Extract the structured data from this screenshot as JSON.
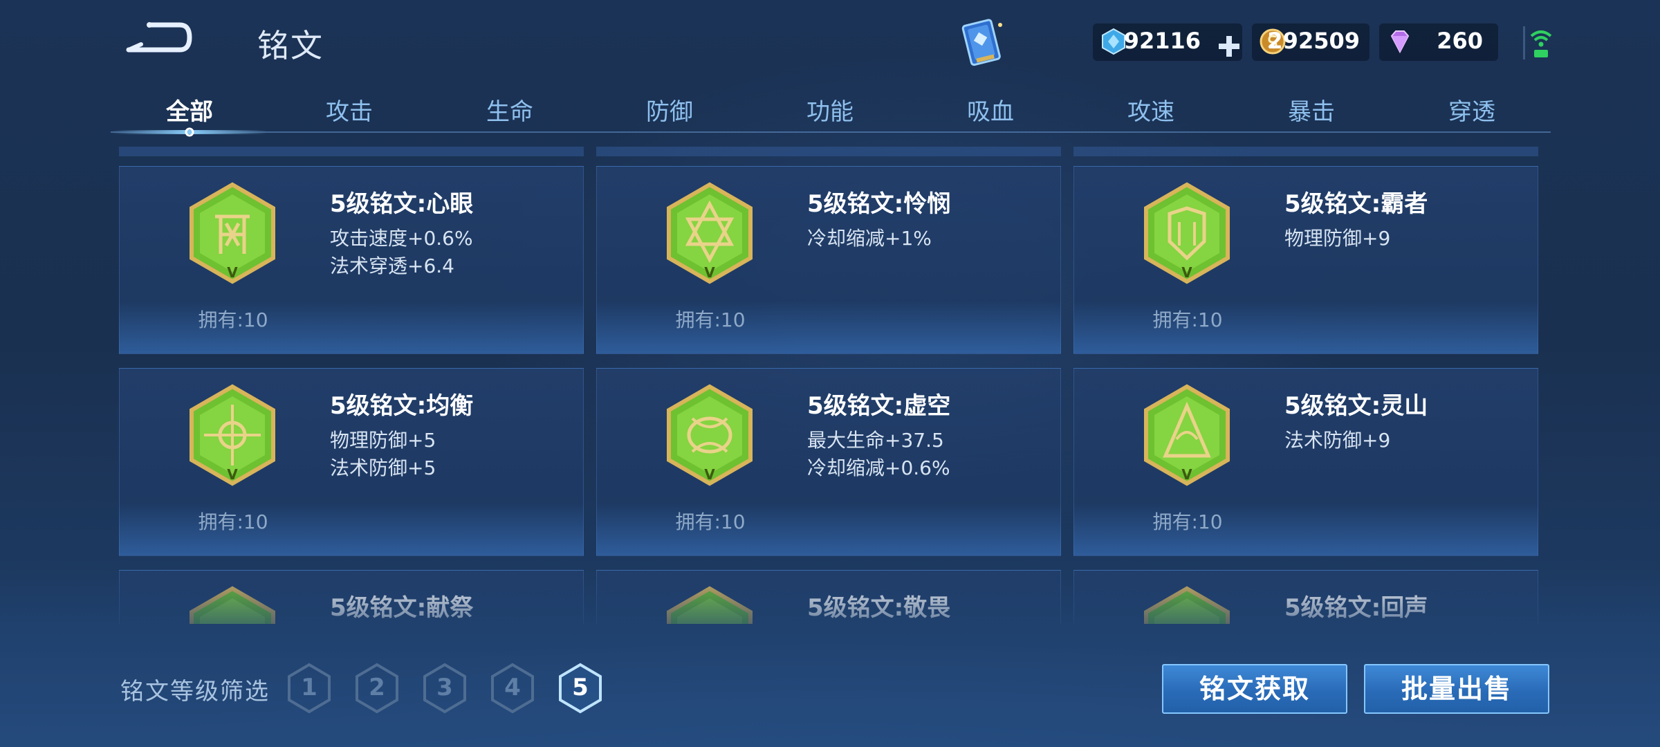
{
  "header": {
    "title": "铭文",
    "currency": {
      "gems": "92116",
      "gold": "292509",
      "diamonds": "260"
    }
  },
  "tabs": [
    {
      "label": "全部",
      "active": true
    },
    {
      "label": "攻击",
      "active": false
    },
    {
      "label": "生命",
      "active": false
    },
    {
      "label": "防御",
      "active": false
    },
    {
      "label": "功能",
      "active": false
    },
    {
      "label": "吸血",
      "active": false
    },
    {
      "label": "攻速",
      "active": false
    },
    {
      "label": "暴击",
      "active": false
    },
    {
      "label": "穿透",
      "active": false
    }
  ],
  "inscriptions": [
    {
      "name": "5级铭文:心眼",
      "stats": [
        "攻击速度+0.6%",
        "法术穿透+6.4"
      ],
      "owned": "拥有:10"
    },
    {
      "name": "5级铭文:怜悯",
      "stats": [
        "冷却缩减+1%"
      ],
      "owned": "拥有:10"
    },
    {
      "name": "5级铭文:霸者",
      "stats": [
        "物理防御+9"
      ],
      "owned": "拥有:10"
    },
    {
      "name": "5级铭文:均衡",
      "stats": [
        "物理防御+5",
        "法术防御+5"
      ],
      "owned": "拥有:10"
    },
    {
      "name": "5级铭文:虚空",
      "stats": [
        "最大生命+37.5",
        "冷却缩减+0.6%"
      ],
      "owned": "拥有:10"
    },
    {
      "name": "5级铭文:灵山",
      "stats": [
        "法术防御+9"
      ],
      "owned": "拥有:10"
    },
    {
      "name": "5级铭文:献祭",
      "stats": [],
      "owned": ""
    },
    {
      "name": "5级铭文:敬畏",
      "stats": [],
      "owned": ""
    },
    {
      "name": "5级铭文:回声",
      "stats": [],
      "owned": ""
    }
  ],
  "filter": {
    "label": "铭文等级筛选",
    "levels": [
      "1",
      "2",
      "3",
      "4",
      "5"
    ],
    "selected": "5"
  },
  "buttons": {
    "obtain": "铭文获取",
    "sell": "批量出售"
  },
  "colors": {
    "accent": "#86c6ff",
    "emblem_green": "#7ed23c",
    "emblem_gold": "#d8b45a"
  }
}
